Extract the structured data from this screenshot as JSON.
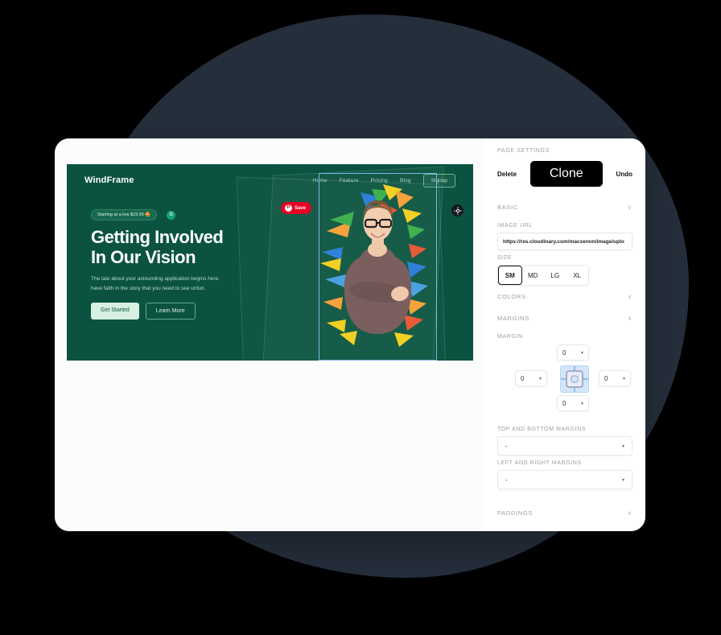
{
  "theme": {
    "blob_color": "#252e3b",
    "hero_green": "#0b5340",
    "accent_black": "#000000",
    "pinterest_red": "#e60023",
    "select_blue": "#7fb6e8",
    "margin_fill": "#d3e6fa"
  },
  "preview": {
    "nav": {
      "logo": "WindFrame",
      "links": [
        "Home",
        "Feature",
        "Pricing",
        "Blog"
      ],
      "signup_label": "Signup"
    },
    "hero": {
      "badge": "Starting at a low $19.99 🤩",
      "badge_dot_glyph": "G",
      "heading_line1": "Getting Involved",
      "heading_line2": "In Our Vision",
      "subtext_line1": "The tale about your astounding application begins here.",
      "subtext_line2": "have faith in the story that you need to see unfurl.",
      "primary_cta": "Get Started",
      "secondary_cta": "Learn More"
    },
    "image_overlay": {
      "pin_save_label": "Save",
      "pin_glyph": "P",
      "crosshair_icon": "target-icon"
    }
  },
  "panel": {
    "title": "PAGE SETTINGS",
    "actions": {
      "delete": "Delete",
      "clone": "Clone",
      "undo": "Undo"
    },
    "sections": {
      "basic": "BASIC",
      "colors": "COLORS",
      "margins": "MARGINS",
      "paddings": "PADDINGS"
    },
    "chevrons": {
      "basic": "∨",
      "colors": "∨",
      "margins": "∧",
      "paddings": "∧"
    },
    "image_url": {
      "label": "IMAGE URL",
      "value": "https://res.cloudinary.com/macxenon/image/uplo"
    },
    "size": {
      "label": "SIZE",
      "options": [
        "SM",
        "MD",
        "LG",
        "XL"
      ],
      "selected": "SM"
    },
    "margin": {
      "label": "MARGIN",
      "top": "0",
      "right": "0",
      "bottom": "0",
      "left": "0",
      "caret": "▾"
    },
    "top_bottom_margins": {
      "label": "TOP AND BOTTOM MARGINS",
      "value": "-",
      "caret": "▾"
    },
    "left_right_margins": {
      "label": "LEFT AND RIGHT MARGINS",
      "value": "-",
      "caret": "▾"
    }
  }
}
